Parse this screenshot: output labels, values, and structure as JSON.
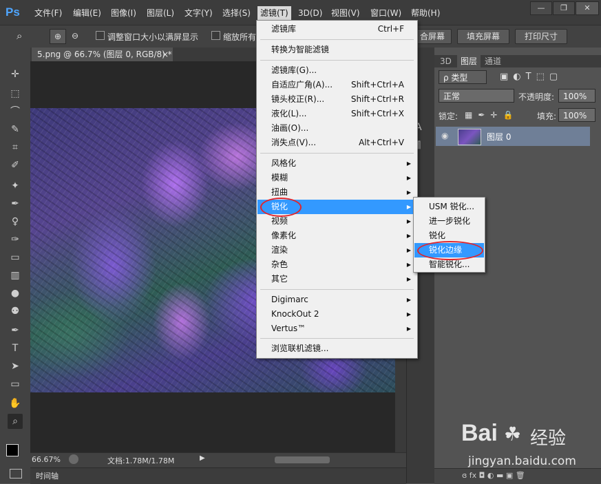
{
  "menubar": {
    "logo": "Ps",
    "items": [
      "文件(F)",
      "编辑(E)",
      "图像(I)",
      "图层(L)",
      "文字(Y)",
      "选择(S)",
      "滤镜(T)",
      "3D(D)",
      "视图(V)",
      "窗口(W)",
      "帮助(H)"
    ],
    "window_buttons": [
      "—",
      "❐",
      "✕"
    ]
  },
  "optbar": {
    "chk1_label": "调整窗口大小以满屏显示",
    "chk2_label": "缩放所有",
    "btn_fill_partial": "合屏幕",
    "btn_fill_screen": "填充屏幕",
    "btn_print_size": "打印尺寸"
  },
  "document": {
    "tab_title": "5.png @ 66.7% (图层 0, RGB/8) *",
    "tab_close": "×",
    "zoom": "66.67%",
    "doc_info": "文档:1.78M/1.78M",
    "timeline": "时间轴"
  },
  "filter_menu": {
    "items": [
      {
        "label": "滤镜库",
        "shortcut": "Ctrl+F"
      },
      {
        "label": "转换为智能滤镜"
      },
      {
        "label": "滤镜库(G)..."
      },
      {
        "label": "自适应广角(A)...",
        "shortcut": "Shift+Ctrl+A"
      },
      {
        "label": "镜头校正(R)...",
        "shortcut": "Shift+Ctrl+R"
      },
      {
        "label": "液化(L)...",
        "shortcut": "Shift+Ctrl+X"
      },
      {
        "label": "油画(O)..."
      },
      {
        "label": "消失点(V)...",
        "shortcut": "Alt+Ctrl+V"
      },
      {
        "label": "风格化"
      },
      {
        "label": "模糊"
      },
      {
        "label": "扭曲"
      },
      {
        "label": "锐化"
      },
      {
        "label": "视频"
      },
      {
        "label": "像素化"
      },
      {
        "label": "渲染"
      },
      {
        "label": "杂色"
      },
      {
        "label": "其它"
      },
      {
        "label": "Digimarc"
      },
      {
        "label": "KnockOut 2"
      },
      {
        "label": "Vertus™"
      },
      {
        "label": "浏览联机滤镜..."
      }
    ]
  },
  "sharpen_submenu": {
    "items": [
      "USM 锐化...",
      "进一步锐化",
      "锐化",
      "锐化边缘",
      "智能锐化..."
    ]
  },
  "layers_panel": {
    "tabs": [
      "3D",
      "图层",
      "通道"
    ],
    "kind_label": "ρ 类型",
    "blend_mode": "正常",
    "opacity_label": "不透明度:",
    "opacity_value": "100%",
    "lock_label": "锁定:",
    "fill_label": "填充:",
    "fill_value": "100%",
    "layer_name": "图层 0",
    "footer_icons": "ɞ  fx  ◘  ◐  ▬  ▣  🗑"
  },
  "watermark": {
    "brand": "Bai",
    "brand_cn": "经验",
    "url": "jingyan.baidu.com"
  },
  "colors": {
    "highlight": "#3399ff",
    "annotation_red": "#e0262c",
    "ps_blue": "#4fa6ff"
  }
}
